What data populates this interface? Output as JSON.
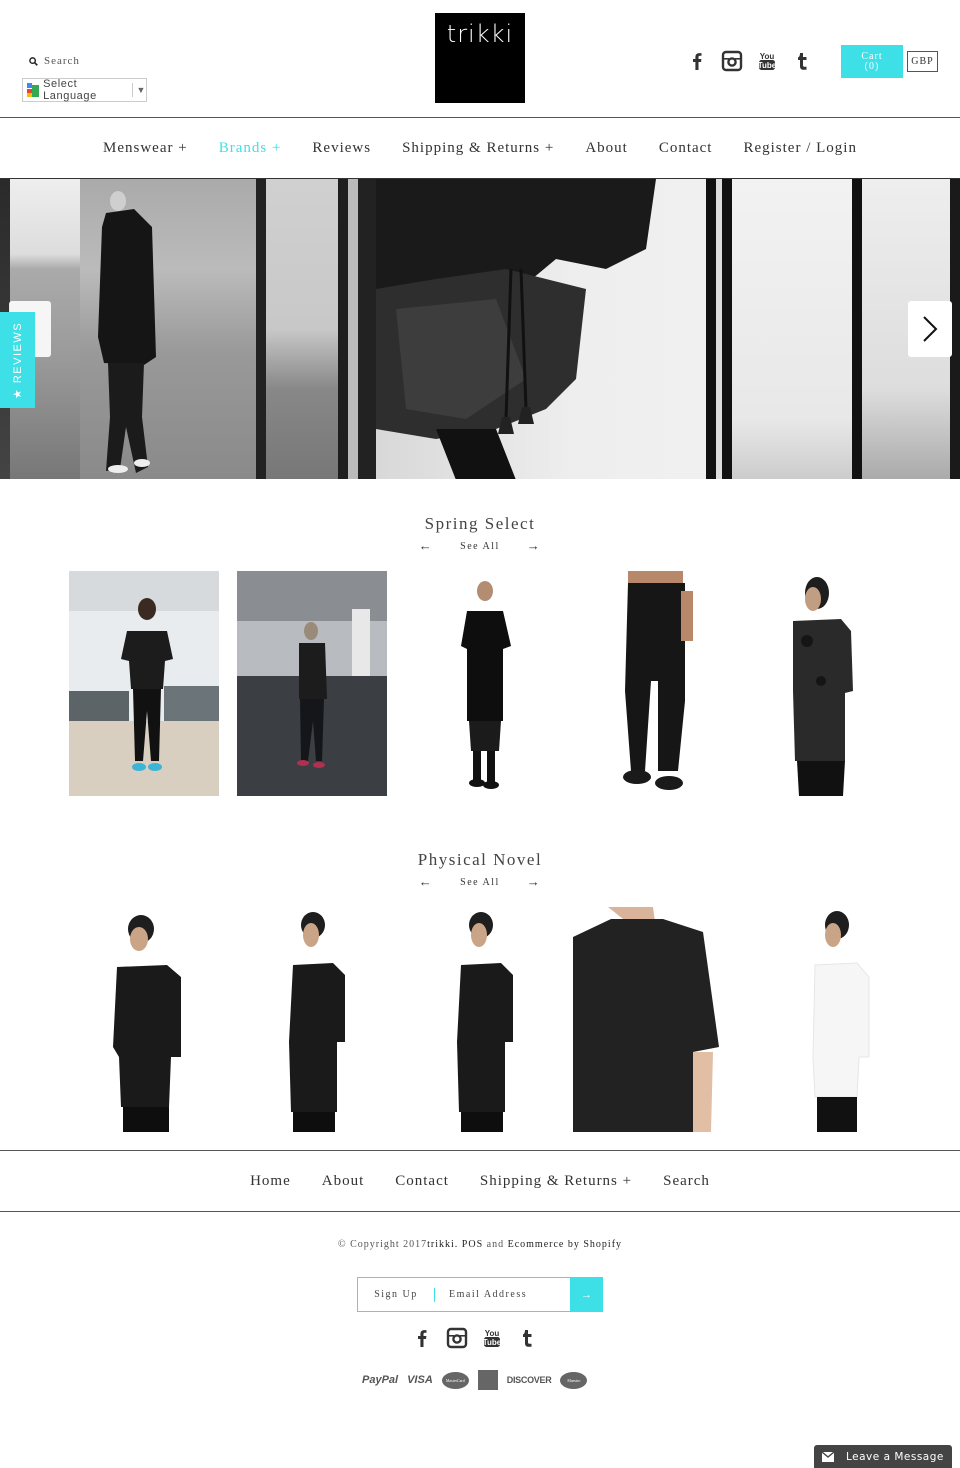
{
  "header": {
    "search_label": "Search",
    "language_select": "Select Language",
    "logo_text": "trikki",
    "socials": [
      "facebook",
      "instagram",
      "youtube",
      "tumblr"
    ],
    "cart_label": "Cart",
    "cart_count": "(0)",
    "currency": "GBP",
    "accent_color": "#3ee0e8"
  },
  "nav": {
    "items": [
      {
        "label": "Menswear +",
        "active": false
      },
      {
        "label": "Brands +",
        "active": true
      },
      {
        "label": "Reviews",
        "active": false
      },
      {
        "label": "Shipping & Returns +",
        "active": false
      },
      {
        "label": "About",
        "active": false
      },
      {
        "label": "Contact",
        "active": false
      },
      {
        "label": "Register / Login",
        "active": false
      }
    ]
  },
  "hero": {
    "next_icon": "chevron-right"
  },
  "reviews_tab": {
    "label": "★ REVIEWS"
  },
  "collections": [
    {
      "title": "Spring Select",
      "see_all": "See All",
      "prev_arrow": "←",
      "next_arrow": "→",
      "products": [
        {
          "alt": "Model in black tee and joggers with teal sneakers, living room"
        },
        {
          "alt": "Model in black tee and shorts with leggings, parking garage"
        },
        {
          "alt": "Model in long black tee, shorts and leggings"
        },
        {
          "alt": "Black drop-crotch trousers with sneakers"
        },
        {
          "alt": "Model in distressed black layered tee"
        }
      ]
    },
    {
      "title": "Physical Novel",
      "see_all": "See All",
      "prev_arrow": "←",
      "next_arrow": "→",
      "products": [
        {
          "alt": "Model in oversized black tee"
        },
        {
          "alt": "Model in long black tee"
        },
        {
          "alt": "Model in long black tee"
        },
        {
          "alt": "Close-up of black tee"
        },
        {
          "alt": "Model in oversized white tee"
        }
      ]
    }
  ],
  "footer": {
    "nav": [
      "Home",
      "About",
      "Contact",
      "Shipping & Returns +",
      "Search"
    ],
    "copyright_prefix": "© Copyright 2017",
    "brand_link": "trikki.",
    "pos_link": "POS",
    "and_text": "and",
    "ecommerce_link": "Ecommerce by Shopify",
    "signup_label": "Sign Up",
    "email_placeholder": "Email Address",
    "submit_arrow": "→",
    "payments": [
      "PayPal",
      "VISA",
      "MasterCard",
      "American Express",
      "DISCOVER",
      "Maestro"
    ]
  },
  "chat": {
    "label": "Leave a Message"
  }
}
